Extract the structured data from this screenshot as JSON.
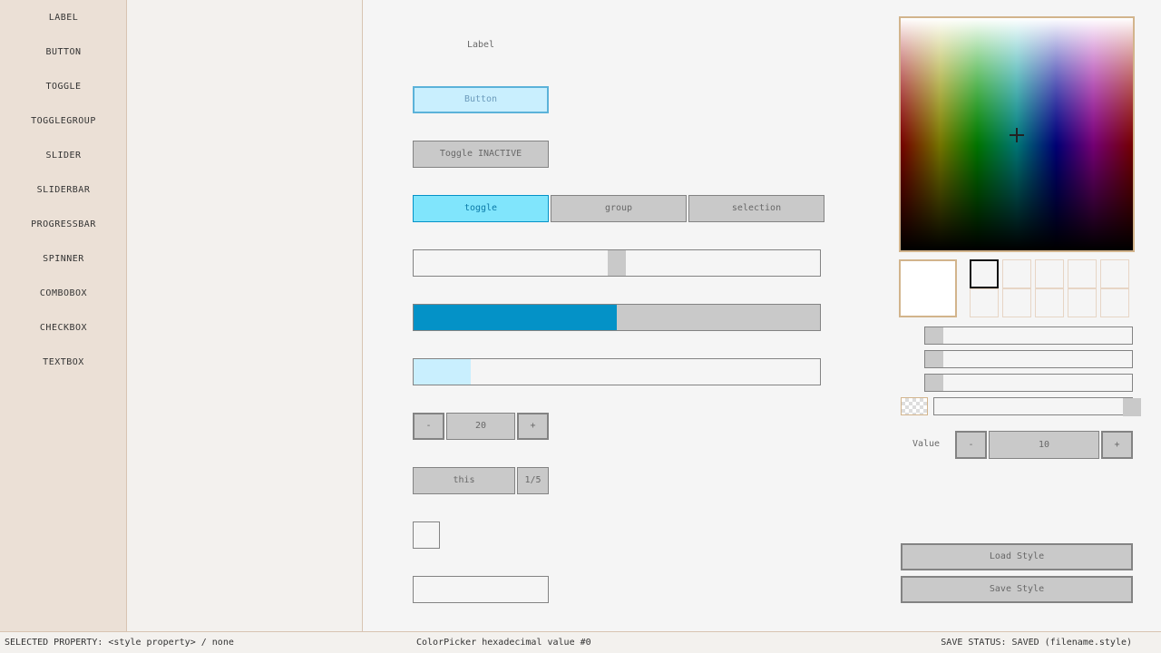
{
  "sidebar": {
    "items": [
      {
        "label": "LABEL"
      },
      {
        "label": "BUTTON"
      },
      {
        "label": "TOGGLE"
      },
      {
        "label": "TOGGLEGROUP"
      },
      {
        "label": "SLIDER"
      },
      {
        "label": "SLIDERBAR"
      },
      {
        "label": "PROGRESSBAR"
      },
      {
        "label": "SPINNER"
      },
      {
        "label": "COMBOBOX"
      },
      {
        "label": "CHECKBOX"
      },
      {
        "label": "TEXTBOX"
      }
    ]
  },
  "preview": {
    "label_text": "Label",
    "button_text": "Button",
    "toggle_text": "Toggle INACTIVE",
    "toggle_group": [
      {
        "label": "toggle",
        "active": true
      },
      {
        "label": "group",
        "active": false
      },
      {
        "label": "selection",
        "active": false
      }
    ],
    "slider_value": 0.5,
    "sliderbar_value": 0.5,
    "progressbar_value": 0.14,
    "spinner": {
      "minus": "-",
      "value": "20",
      "plus": "+"
    },
    "combobox": {
      "selected": "this",
      "count": "1/5"
    },
    "checkbox_checked": false,
    "textbox_value": ""
  },
  "color_panel": {
    "selected_color": "#ffffff",
    "swatch_count": 10,
    "selected_swatch": 0,
    "channel_values": [
      0,
      0,
      0
    ],
    "alpha_value": 1.0,
    "value_label": "Value",
    "spinner": {
      "minus": "-",
      "value": "10",
      "plus": "+"
    },
    "load_label": "Load Style",
    "save_label": "Save Style"
  },
  "status": {
    "selected_property": "SELECTED PROPERTY: <style property> / none",
    "colorpicker_hex": "ColorPicker hexadecimal value #0",
    "save_status": "SAVE STATUS: SAVED (filename.style)"
  },
  "colors": {
    "sidebar_bg": "#ebe0d6",
    "accent": "#0492c7",
    "accent_light": "#c9effe",
    "border": "#838383",
    "control_bg": "#c9c9c9",
    "panel_border": "#d2b48c"
  }
}
